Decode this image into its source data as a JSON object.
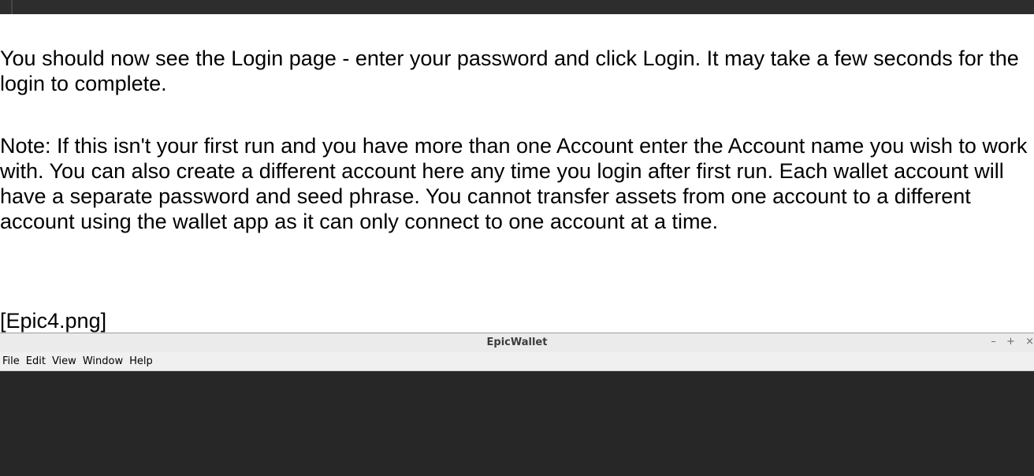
{
  "doc": {
    "paragraph1": "You should now see the Login page - enter your password and click Login. It may take a few seconds for the login to complete.",
    "paragraph2": "Note: If this isn't your first run and you have more than one Account enter the Account name you wish to work with. You can also create a different account here any time you login after first run. Each wallet account will have a separate password and seed phrase. You cannot transfer assets from one account to a different account using the wallet app as it can only connect to one account at a time.",
    "image_caption": "[Epic4.png]"
  },
  "app": {
    "title": "EpicWallet",
    "window_buttons": {
      "minimize": "–",
      "maximize": "+",
      "close": "×"
    },
    "menu": [
      "File",
      "Edit",
      "View",
      "Window",
      "Help"
    ]
  },
  "colors": {
    "top_strip": "#2d2d2d",
    "app_content_bg": "#272727",
    "titlebar_bg": "#ebebeb",
    "menubar_bg": "#f0f0f0"
  }
}
